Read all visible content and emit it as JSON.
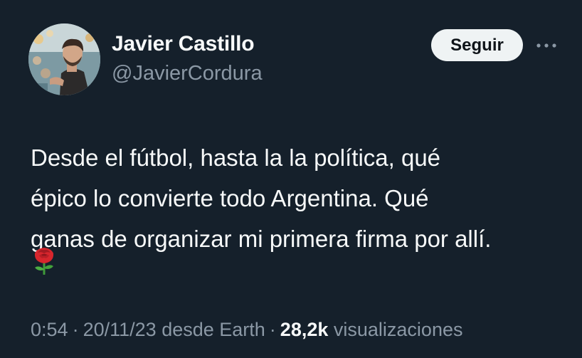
{
  "author": {
    "name": "Javier Castillo",
    "handle": "@JavierCordura"
  },
  "follow_button": {
    "label": "Seguir"
  },
  "more_icon": "more-horizontal-icon",
  "tweet": {
    "lines": [
      "Desde el fútbol, hasta la la política, qué",
      "épico lo convierte todo Argentina. Qué",
      "ganas de organizar mi primera firma por allí."
    ],
    "emoji": "rose-icon"
  },
  "meta": {
    "time": "0:54",
    "separator": "·",
    "date": "20/11/23",
    "source": "desde Earth",
    "views_count": "28,2k",
    "views_label": "visualizaciones"
  },
  "colors": {
    "background": "#15202b",
    "text_primary": "#f7f9f9",
    "text_secondary": "#8b98a5",
    "button_bg": "#eff3f4"
  }
}
